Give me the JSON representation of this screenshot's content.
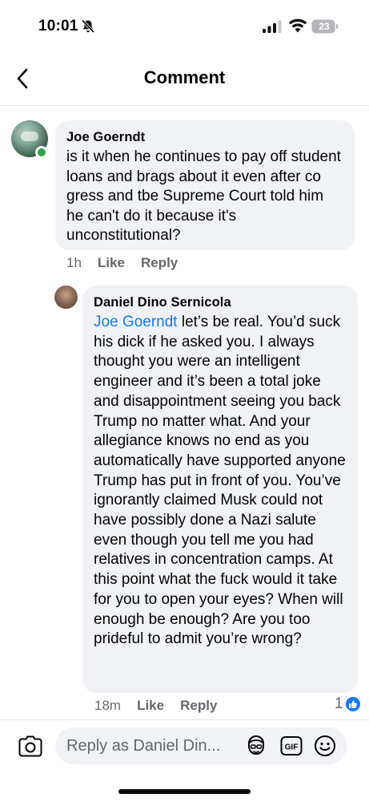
{
  "status_bar": {
    "time": "10:01",
    "battery_level": "23",
    "icons": [
      "bell-off-icon",
      "cellular-signal-icon",
      "wifi-icon",
      "battery-icon"
    ]
  },
  "header": {
    "title": "Comment",
    "back_icon": "chevron-left-icon"
  },
  "comments": [
    {
      "author": "Joe Goerndt",
      "online": true,
      "text": "is it when he continues to pay off student loans and brags about it even after co gress and tbe Supreme Court told him he can't do it because it's unconstitutional?",
      "age": "1h",
      "like_label": "Like",
      "reply_label": "Reply"
    },
    {
      "author": "Daniel Dino Sernicola",
      "mention": "Joe Goerndt",
      "text": " let’s be real. You’d suck his dick if he asked you. I always thought you were an intelligent engineer and it’s been a total joke and disappointment seeing you back Trump no matter what. And your allegiance knows no end as you automatically have supported anyone Trump has put in front of you. You’ve ignorantly claimed Musk could not have possibly done a Nazi salute even though you tell me you had relatives in concentration camps. At this point what the fuck would it take for you to open your eyes? When will enough be enough? Are you too prideful to admit you’re wrong?",
      "age": "18m",
      "like_label": "Like",
      "reply_label": "Reply",
      "reaction_count": "1",
      "reaction_icon": "like-reaction-icon"
    }
  ],
  "composer": {
    "placeholder": "Reply as Daniel Din...",
    "icons": [
      "camera-icon",
      "avatar-sticker-icon",
      "gif-icon",
      "emoji-icon"
    ],
    "gif_label": "GIF"
  },
  "colors": {
    "accent": "#1877f2",
    "bubble": "#f0f2f5",
    "secondary_text": "#65676b",
    "online": "#31a24c"
  }
}
